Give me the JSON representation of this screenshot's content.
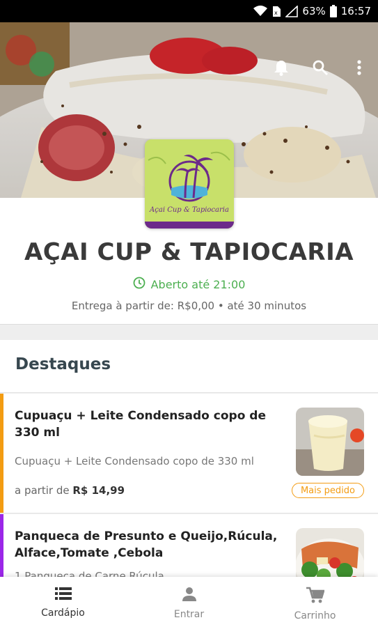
{
  "status_bar": {
    "battery": "63%",
    "time": "16:57"
  },
  "hero": {
    "icons": [
      "bell-icon",
      "search-icon",
      "more-vert-icon"
    ]
  },
  "store": {
    "name": "AÇAI CUP & TAPIOCARIA",
    "logo_text": "Açai Cup & Tapiocaria",
    "open_status": "Aberto até 21:00",
    "delivery": "Entrega à partir de: R$0,00 • até 30 minutos",
    "open_color": "#4caf50"
  },
  "highlights": {
    "title": "Destaques",
    "items": [
      {
        "name": "Cupuaçu + Leite Condensado copo de 330 ml",
        "description": "Cupuaçu + Leite Condensado copo de 330 ml",
        "price_prefix": "a partir de",
        "price": "R$ 14,99",
        "badge": "Mais pedido",
        "accent_color": "#f39c12"
      },
      {
        "name": "Panqueca de Presunto e Queijo,Rúcula, Alface,Tomate ,Cebola",
        "description": "1 Panqueca de Carne Rúcula",
        "accent_color": "#9b27e8"
      }
    ]
  },
  "bottom_nav": {
    "items": [
      {
        "label": "Cardápio",
        "icon": "menu-list-icon",
        "active": true
      },
      {
        "label": "Entrar",
        "icon": "person-icon",
        "active": false
      },
      {
        "label": "Carrinho",
        "icon": "cart-icon",
        "active": false
      }
    ]
  }
}
